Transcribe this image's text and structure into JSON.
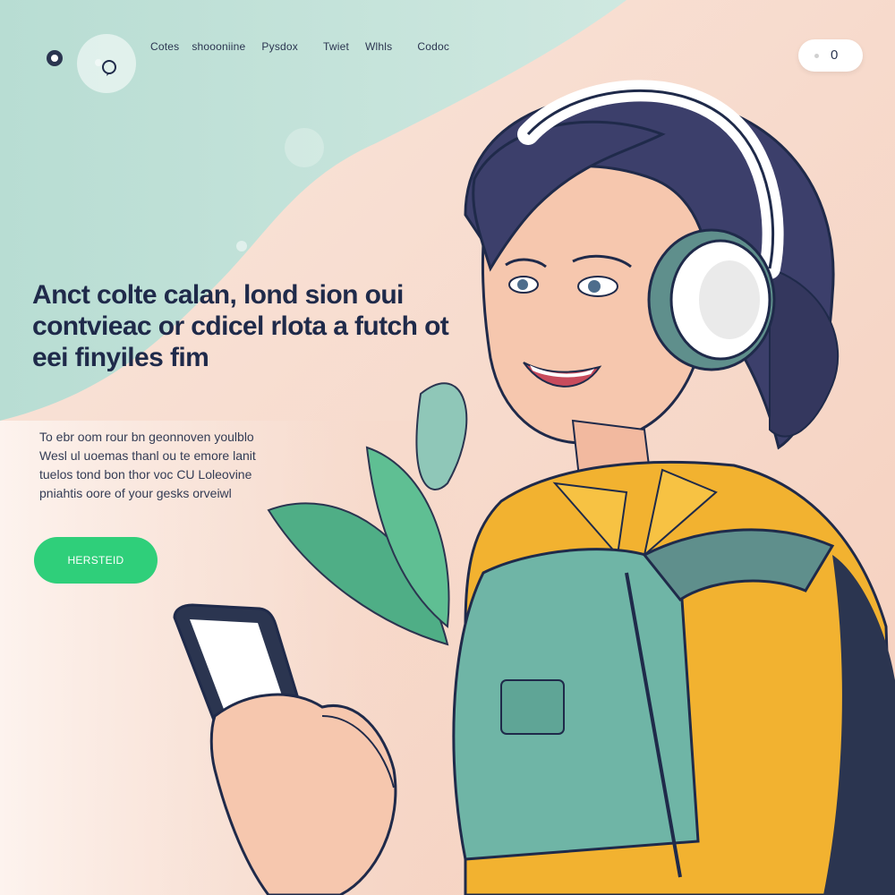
{
  "nav": {
    "items": [
      {
        "label": "Cotes"
      },
      {
        "label": "shoooniine"
      },
      {
        "label": "Pysdox"
      },
      {
        "label": "Twiet"
      },
      {
        "label": "Wlhls"
      },
      {
        "label": "Codoc"
      }
    ]
  },
  "toggle": {
    "value": "0"
  },
  "hero": {
    "headline_lines": [
      "Anct colte calan, lond sion oui",
      "contvieac or cdicel rlota a futch ot",
      "eei finyiles fim"
    ],
    "subcopy_lines": [
      "To ebr oom rour bn geonnoven youlblo",
      "Wesl ul uoemas thanl ou te emore lanit",
      "tuelos tond bon thor voc CU Loleovine",
      "pniahtis oore of your gesks orveiwl"
    ],
    "cta_label": "HERSTEID"
  },
  "colors": {
    "accent": "#2fcf7a",
    "headline": "#1f2a4a",
    "background_mint": "#bfe0d6",
    "background_peach": "#f7d9c8"
  },
  "icons": [
    "logo-icon",
    "chat-bubble-icon"
  ]
}
